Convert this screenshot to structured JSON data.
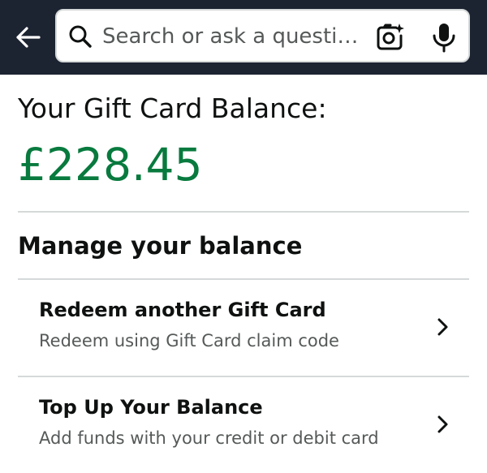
{
  "header": {
    "back_icon": "arrow-left-icon",
    "search": {
      "placeholder": "Search or ask a questi…",
      "search_icon": "magnifier-icon",
      "camera_icon": "camera-sparkle-icon",
      "mic_icon": "microphone-icon"
    },
    "bar_color": "#1c2331"
  },
  "balance": {
    "label": "Your Gift Card Balance:",
    "amount": "£228.45",
    "amount_color": "#087a3e"
  },
  "manage": {
    "title": "Manage your balance",
    "items": [
      {
        "title": "Redeem another Gift Card",
        "subtitle": "Redeem using Gift Card claim code",
        "icon": "chevron-right-icon"
      },
      {
        "title": "Top Up Your Balance",
        "subtitle": "Add funds with your credit or debit card",
        "icon": "chevron-right-icon"
      }
    ]
  }
}
